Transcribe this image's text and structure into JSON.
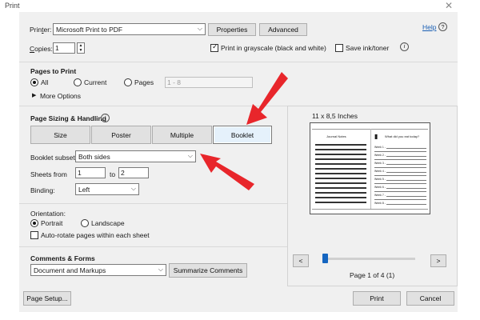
{
  "window": {
    "title": "Print",
    "close_icon": "close-icon"
  },
  "printer": {
    "label": "Printer:",
    "value": "Microsoft Print to PDF",
    "properties_label": "Properties",
    "advanced_label": "Advanced",
    "help_label": "Help",
    "help_icon": "question-circle-icon"
  },
  "copies": {
    "label": "Copies:",
    "value": "1"
  },
  "options": {
    "grayscale_label": "Print in grayscale (black and white)",
    "grayscale_checked": true,
    "save_ink_label": "Save ink/toner",
    "save_ink_checked": false,
    "info_icon": "info-icon"
  },
  "pages_to_print": {
    "heading": "Pages to Print",
    "all_label": "All",
    "current_label": "Current",
    "pages_label": "Pages",
    "pages_value": "1 - 8",
    "selected": "All",
    "more_options_label": "More Options"
  },
  "sizing": {
    "heading": "Page Sizing & Handling",
    "info_icon": "info-icon",
    "tabs": [
      {
        "label": "Size",
        "selected": false
      },
      {
        "label": "Poster",
        "selected": false
      },
      {
        "label": "Multiple",
        "selected": false
      },
      {
        "label": "Booklet",
        "selected": true
      }
    ],
    "booklet_subset_label": "Booklet subset:",
    "booklet_subset_value": "Both sides",
    "sheets_from_label": "Sheets from",
    "sheets_from_value": "1",
    "sheets_to_label": "to",
    "sheets_to_value": "2",
    "binding_label": "Binding:",
    "binding_value": "Left"
  },
  "orientation": {
    "heading": "Orientation:",
    "portrait_label": "Portrait",
    "landscape_label": "Landscape",
    "selected": "Portrait",
    "auto_rotate_label": "Auto-rotate pages within each sheet",
    "auto_rotate_checked": false
  },
  "comments": {
    "heading": "Comments & Forms",
    "value": "Document and Markups",
    "summarize_label": "Summarize Comments"
  },
  "preview": {
    "size_label": "11 x 8,5 Inches",
    "left_page_title": "Journal Notes",
    "right_page_title": "What did you eat today?",
    "right_rows": [
      "Week 1 -",
      "Week 2 -",
      "Week 3 -",
      "Week 4 -",
      "Week 5 -",
      "Week 6 -",
      "Week 7 -",
      "Week 8 -"
    ],
    "prev_label": "<",
    "next_label": ">",
    "page_indicator": "Page 1 of 4 (1)",
    "slider_position": 0
  },
  "footer": {
    "page_setup_label": "Page Setup...",
    "print_label": "Print",
    "cancel_label": "Cancel"
  },
  "annotations": {
    "arrow_color": "#e8262b"
  }
}
